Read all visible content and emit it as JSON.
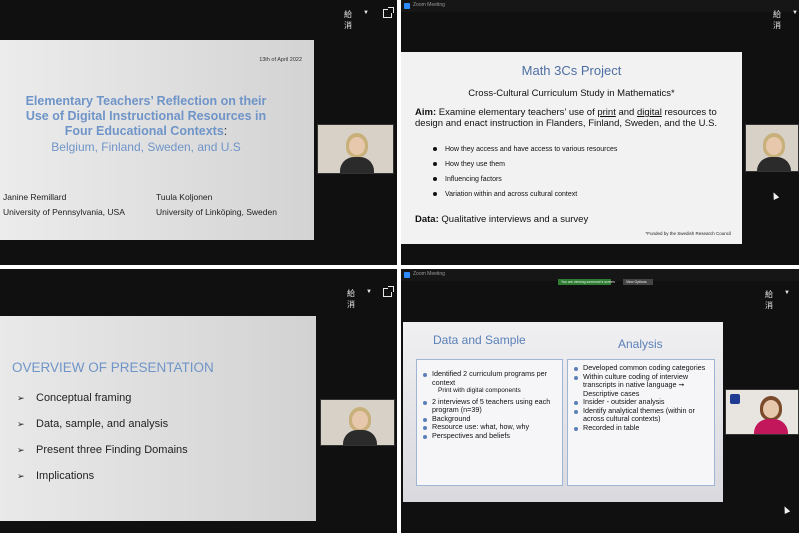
{
  "panels": {
    "top_left": {
      "view_label": "給消",
      "slide": {
        "date": "13th of April 2022",
        "title": "Elementary Teachers’ Reflection on their Use of Digital Instructional Resources in Four Educational Contexts",
        "colon": ":",
        "subtitle": "Belgium, Finland, Sweden, and U.S",
        "author1_name": "Janine Remillard",
        "author1_affil": "University of Pennsylvania, USA",
        "author2_name": "Tuula Koljonen",
        "author2_affil": "University of Linköping, Sweden"
      }
    },
    "top_right": {
      "window_title": "Zoom Meeting",
      "view_label": "給消",
      "slide": {
        "title": "Math 3Cs Project",
        "subtitle": "Cross-Cultural Curriculum Study in Mathematics*",
        "aim_label": "Aim:",
        "aim_text_1": " Examine elementary teachers’ use of ",
        "aim_print": "print",
        "aim_and": " and ",
        "aim_digital": "digital",
        "aim_text_2": " resources to design and enact instruction in  Flanders, Finland, Sweden, and the U.S.",
        "bullets": [
          "How they access and have access to various resources",
          "How they use them",
          "Influencing factors",
          "Variation within and across cultural context"
        ],
        "data_label": "Data:",
        "data_text": " Qualitative interviews and a survey",
        "footnote": "*Funded by the Swedish Research Council"
      }
    },
    "bottom_left": {
      "view_label": "給消",
      "slide": {
        "title": "OVERVIEW OF PRESENTATION",
        "items": [
          "Conceptual framing",
          "Data, sample, and analysis",
          "Present three Finding Domains",
          "Implications"
        ]
      }
    },
    "bottom_right": {
      "window_title": "Zoom Meeting",
      "view_label": "給消",
      "green_bar_text": "You are viewing someone's screen",
      "gray_bar_text": "View Options",
      "slide": {
        "left_title": "Data and Sample",
        "right_title": "Analysis",
        "left_items": [
          {
            "text": "Identified 2 curriculum programs per context",
            "bullet": true
          },
          {
            "text": "Print with digital components",
            "bullet": false
          },
          {
            "text": "2 interviews of 5 teachers using each program (n=39)",
            "bullet": true
          },
          {
            "text": "Background",
            "bullet": true
          },
          {
            "text": "Resource use: what, how, why",
            "bullet": true
          },
          {
            "text": "Perspectives and beliefs",
            "bullet": true
          }
        ],
        "right_items": [
          "Developed common coding categories",
          "Within culture coding of interview transcripts in native language ➞ Descriptive cases",
          "Insider - outsider analysis",
          "Identify analytical themes (within or across cultural contexts)",
          "Recorded in table"
        ]
      }
    }
  },
  "colors": {
    "slide_blue": "#6f94c8",
    "title_blue": "#4e6fa3",
    "zoom_green": "#2e7d32",
    "background": "#101010"
  }
}
